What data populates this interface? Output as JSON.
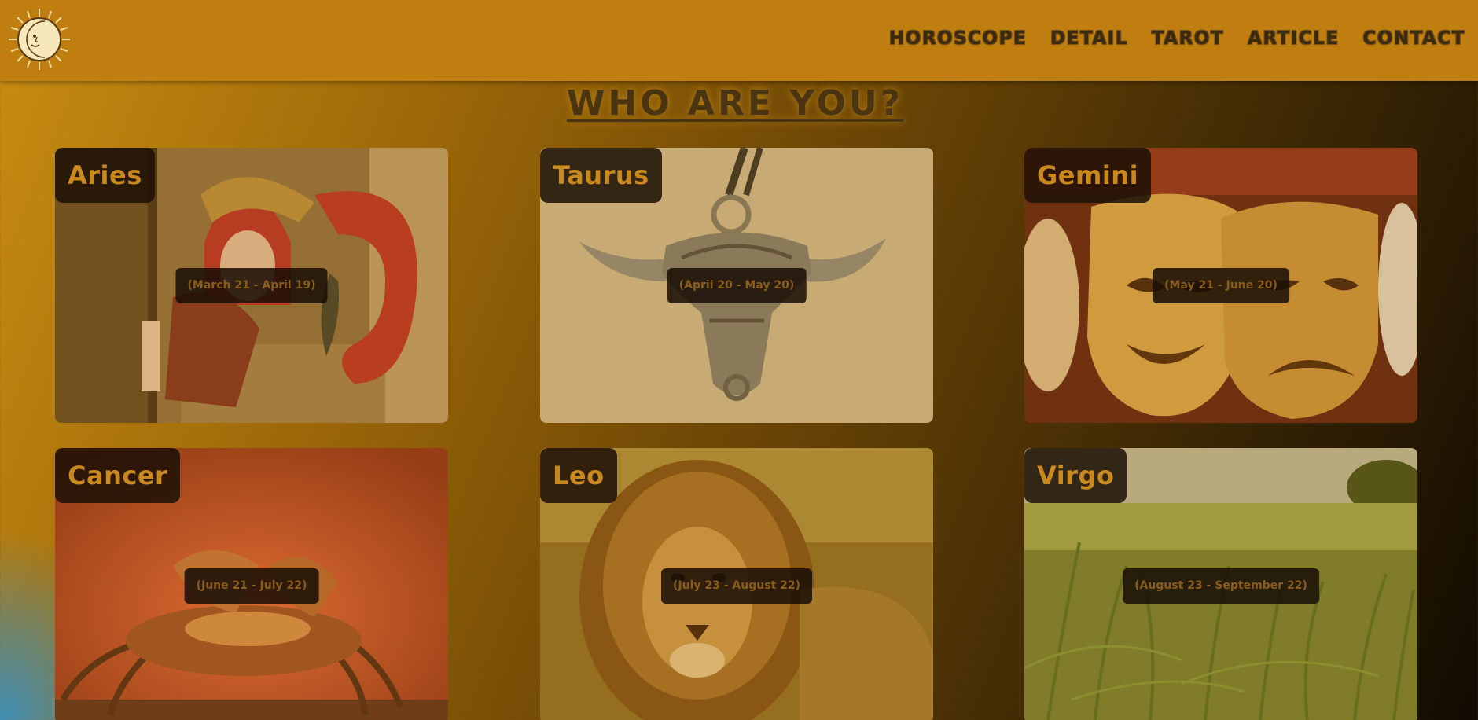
{
  "header": {
    "logo_icon": "sun-moon-face-icon",
    "nav": [
      "HOROSCOPE",
      "DETAIL",
      "TAROT",
      "ARTICLE",
      "CONTACT"
    ]
  },
  "main": {
    "title": "WHO ARE YOU?",
    "signs": [
      {
        "name": "Aries",
        "dates": "(March 21 - April 19)"
      },
      {
        "name": "Taurus",
        "dates": "(April 20 - May 20)"
      },
      {
        "name": "Gemini",
        "dates": "(May 21 - June 20)"
      },
      {
        "name": "Cancer",
        "dates": "(June 21 - July 22)"
      },
      {
        "name": "Leo",
        "dates": "(July 23 - August 22)"
      },
      {
        "name": "Virgo",
        "dates": "(August 23 - September 22)"
      }
    ]
  },
  "colors": {
    "navbar": "#c07e10",
    "label_bg": "#1c1006",
    "label_text": "#c9891c"
  }
}
